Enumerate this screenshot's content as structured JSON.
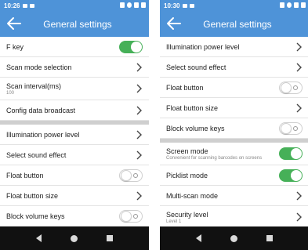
{
  "left": {
    "status_time": "10:26",
    "title": "General settings",
    "items": [
      {
        "label": "F key"
      },
      {
        "label": "Scan mode selection"
      },
      {
        "label": "Scan interval(ms)",
        "sub": "100"
      },
      {
        "label": "Config data broadcast"
      },
      {
        "label": "Illumination power level"
      },
      {
        "label": "Select sound effect"
      },
      {
        "label": "Float button"
      },
      {
        "label": "Float button size"
      },
      {
        "label": "Block volume keys"
      }
    ]
  },
  "right": {
    "status_time": "10:30",
    "title": "General settings",
    "items": [
      {
        "label": "Illumination power level"
      },
      {
        "label": "Select sound effect"
      },
      {
        "label": "Float button"
      },
      {
        "label": "Float button size"
      },
      {
        "label": "Block volume keys"
      },
      {
        "label": "Screen mode",
        "sub": "Convenient for scanning barcodes on screens"
      },
      {
        "label": "Picklist mode"
      },
      {
        "label": "Multi-scan mode"
      },
      {
        "label": "Security level",
        "sub": "Level 1"
      }
    ]
  },
  "icons": {
    "back": "arrow-left-icon",
    "chevron": "chevron-right-icon",
    "nav_back": "triangle-back-icon",
    "nav_home": "circle-home-icon",
    "nav_recent": "square-recent-icon"
  },
  "colors": {
    "appbar": "#4e93d8",
    "toggle_on": "#46b058",
    "divider": "#cfcfcf",
    "navbar": "#111111"
  },
  "toggles": {
    "left_f_key": true,
    "left_float_button": false,
    "left_block_volume_keys": false,
    "right_float_button": false,
    "right_block_volume_keys": false,
    "right_screen_mode": true,
    "right_picklist_mode": true
  }
}
